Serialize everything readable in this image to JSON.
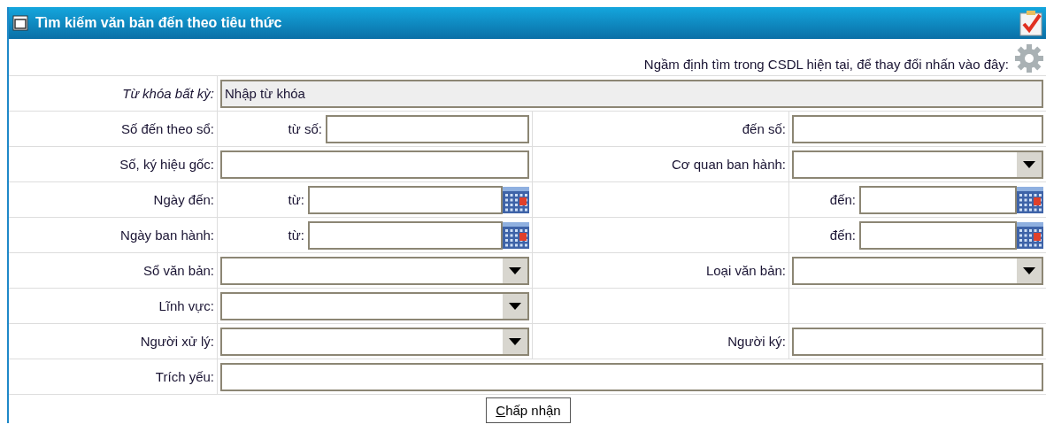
{
  "panel": {
    "title": "Tìm kiếm văn bản đến theo tiêu thức",
    "notice": "Ngầm định tìm trong CSDL hiện tại, để thay đổi nhấn vào đây:"
  },
  "rows": [
    {
      "kind": "keyword",
      "label": "Từ khóa bất kỳ:",
      "placeholder": "Nhập từ khóa"
    },
    {
      "kind": "number_range",
      "label": "Số đến theo sổ:",
      "from_label": "từ số:",
      "to_label": "đến số:"
    },
    {
      "kind": "pair",
      "left": {
        "label": "Số, ký hiệu gốc:",
        "kind": "text"
      },
      "right": {
        "label": "Cơ quan ban hành:",
        "kind": "select"
      }
    },
    {
      "kind": "date_range",
      "label": "Ngày đến:",
      "from_label": "từ:",
      "to_label": "đến:"
    },
    {
      "kind": "date_range",
      "label": "Ngày ban hành:",
      "from_label": "từ:",
      "to_label": "đến:"
    },
    {
      "kind": "pair",
      "left": {
        "label": "Sổ văn bản:",
        "kind": "select"
      },
      "right": {
        "label": "Loại văn bản:",
        "kind": "select"
      }
    },
    {
      "kind": "pair",
      "left": {
        "label": "Lĩnh vực:",
        "kind": "select"
      }
    },
    {
      "kind": "pair",
      "left": {
        "label": "Người xử lý:",
        "kind": "select"
      },
      "right": {
        "label": "Người ký:",
        "kind": "text"
      }
    },
    {
      "kind": "wide",
      "label": "Trích yếu:"
    }
  ],
  "submit": {
    "label": "Chấp nhận"
  }
}
